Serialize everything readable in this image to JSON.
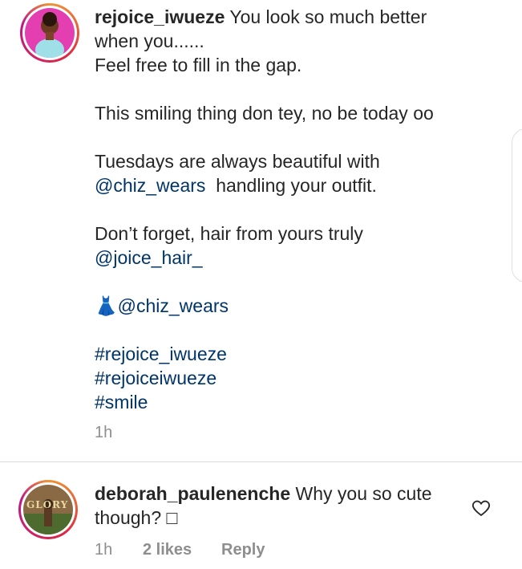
{
  "post": {
    "username": "rejoice_iwueze",
    "caption_first": "You look so much better",
    "caption_lines": {
      "l1": "when you......",
      "l2": "Feel free to fill in the gap.",
      "l3": "This smiling thing don tey, no be today oo",
      "l4": "Tuesdays are always beautiful with",
      "l5_mention": "@chiz_wears",
      "l5_rest": "handling your outfit.",
      "l6": "Don’t forget, hair from yours truly",
      "l7_mention": "@joice_hair_",
      "l8_emoji": "👗",
      "l8_mention": "@chiz_wears",
      "tag1": "#rejoice_iwueze",
      "tag2": "#rejoiceiwueze",
      "tag3": "#smile"
    },
    "time": "1h"
  },
  "comment": {
    "username": "deborah_paulenenche",
    "text_first": "Why you so cute",
    "text_second": "though? ",
    "text_emoji": "□",
    "time": "1h",
    "likes": "2 likes",
    "reply": "Reply",
    "avatar_text": "GLORY"
  }
}
